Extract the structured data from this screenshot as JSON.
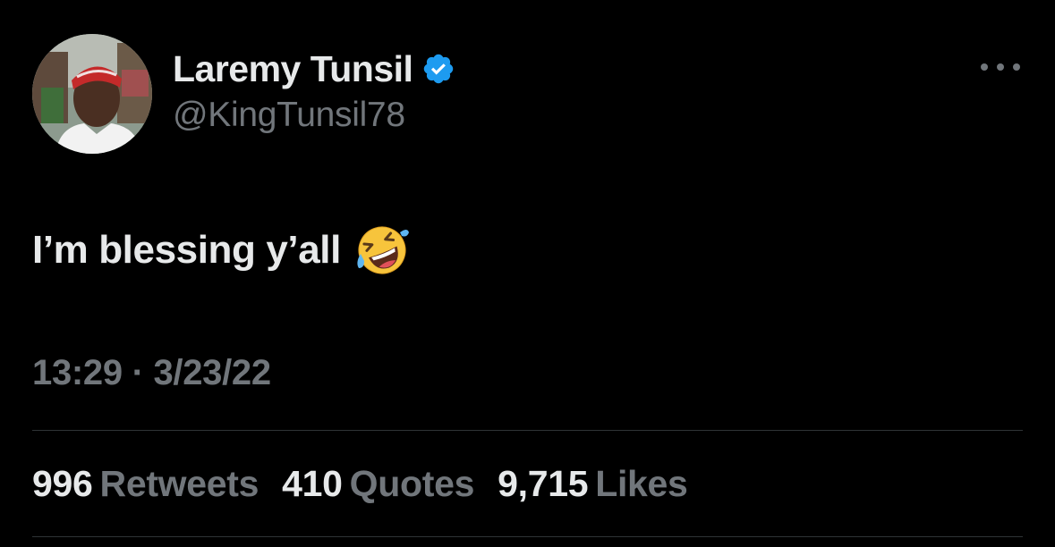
{
  "author": {
    "display_name": "Laremy Tunsil",
    "handle": "@KingTunsil78",
    "verified": true,
    "avatar_icon": "profile-photo"
  },
  "more_icon": "ellipsis-icon",
  "tweet": {
    "text": "I’m blessing y’all",
    "emoji": "rolling-on-the-floor-laughing-emoji",
    "timestamp": "13:29 · 3/23/22"
  },
  "stats": {
    "retweets": {
      "count": "996",
      "label": "Retweets"
    },
    "quotes": {
      "count": "410",
      "label": "Quotes"
    },
    "likes": {
      "count": "9,715",
      "label": "Likes"
    }
  },
  "colors": {
    "background": "#000000",
    "primary_text": "#e7e9ea",
    "secondary_text": "#71767b",
    "verified_blue": "#1d9bf0",
    "divider": "#2f3336"
  }
}
